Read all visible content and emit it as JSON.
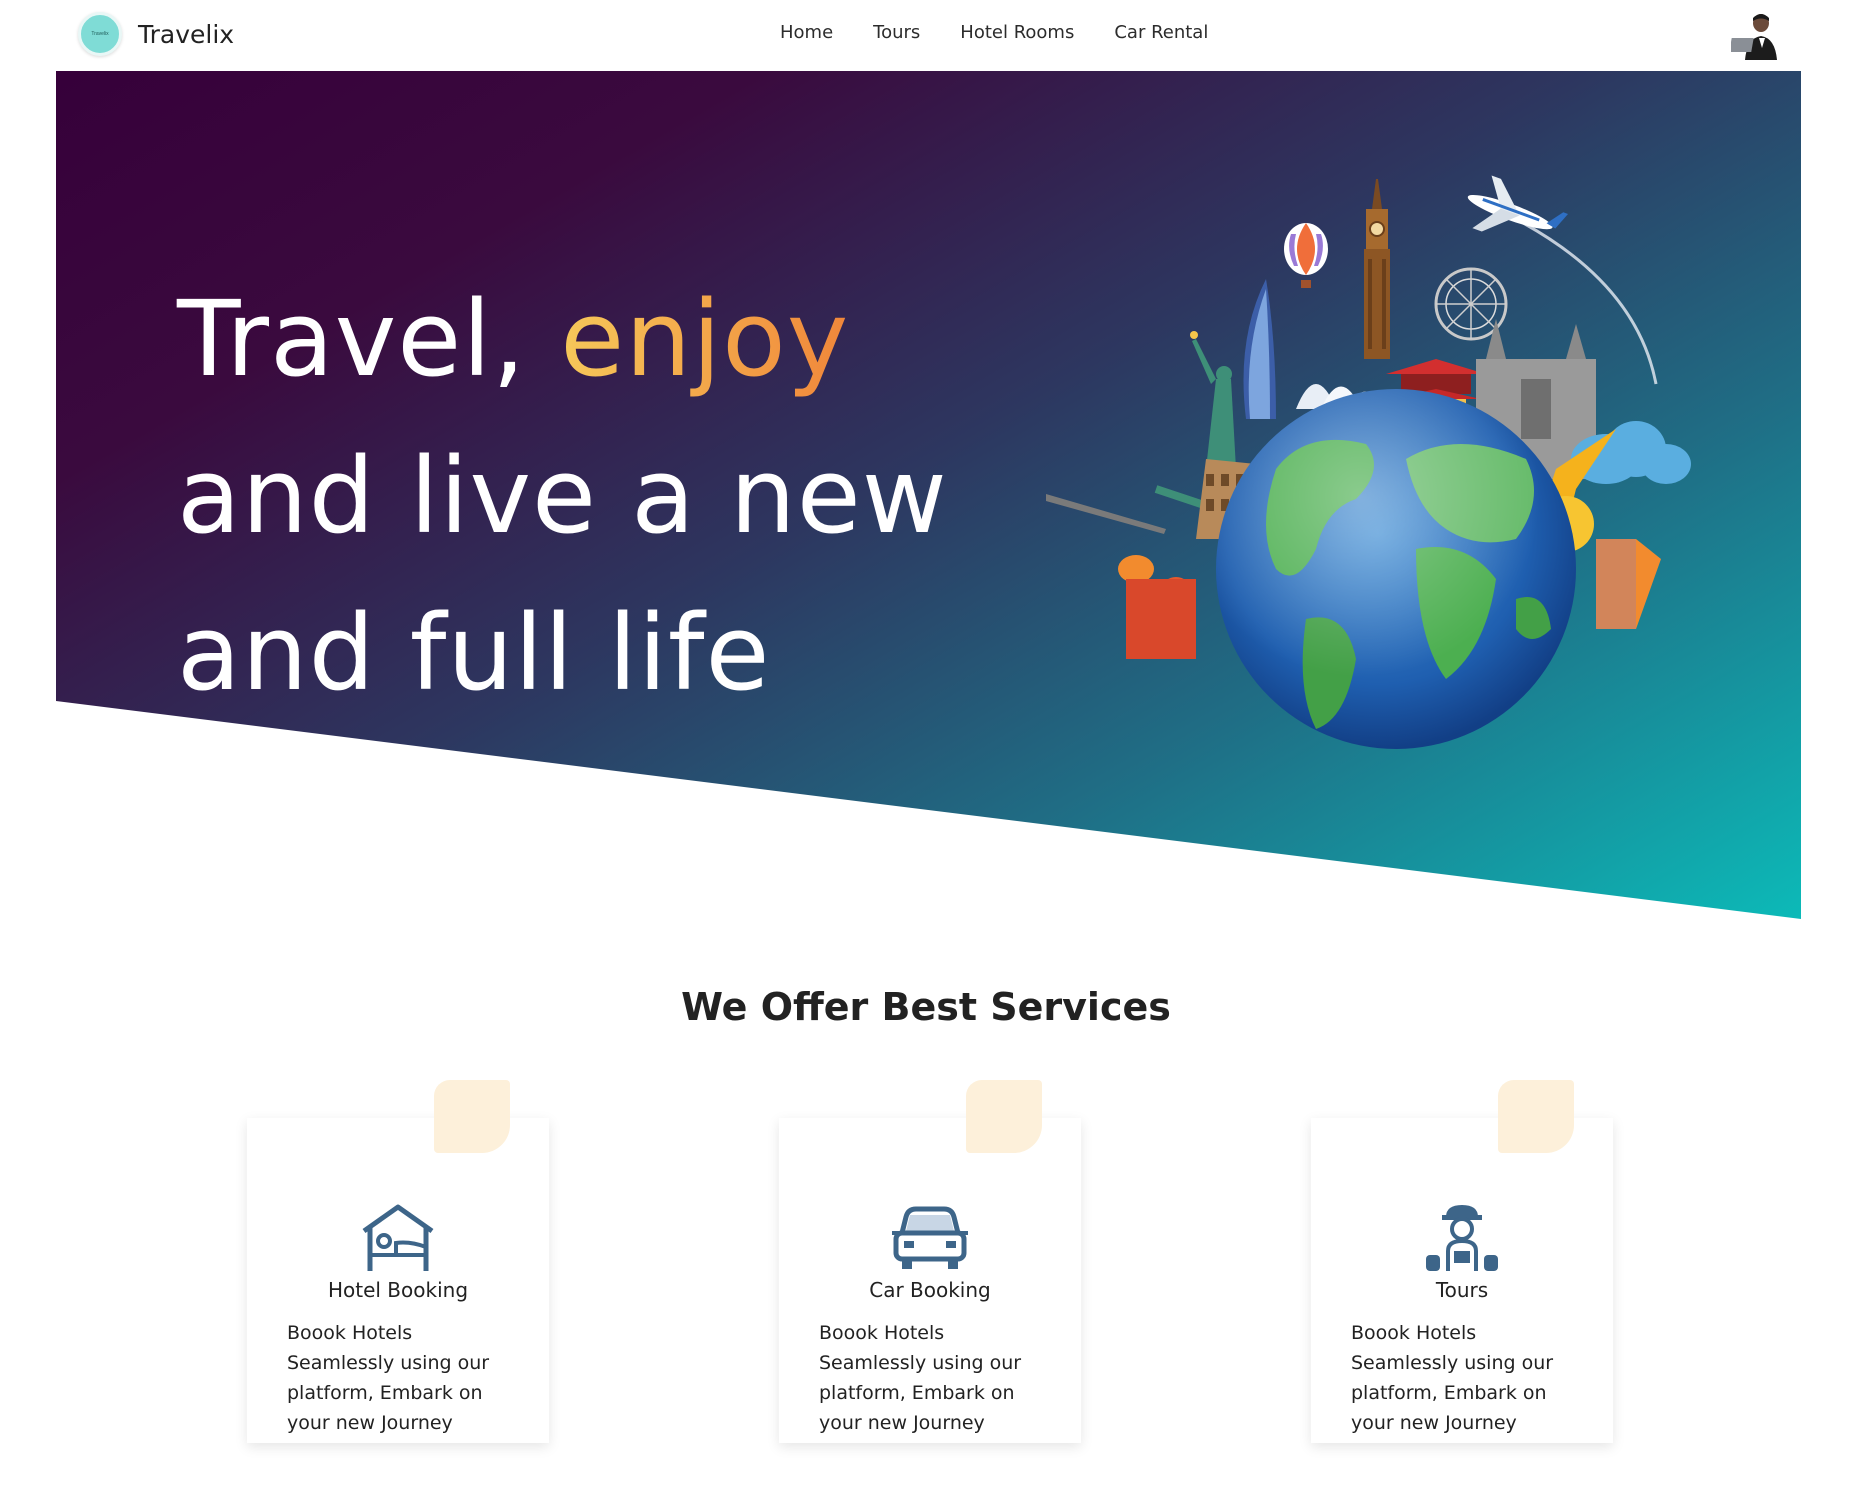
{
  "brand": {
    "name": "Travelix",
    "logo_text": "Travelix"
  },
  "nav": {
    "items": [
      "Home",
      "Tours",
      "Hotel Rooms",
      "Car Rental"
    ]
  },
  "hero": {
    "line1_part1": "Travel,",
    "line1_accent": "enjoy",
    "line2": "and live a new",
    "line3": "and full life"
  },
  "services": {
    "title": "We Offer Best Services",
    "cards": [
      {
        "icon": "hotel-bed-icon",
        "title": "Hotel Booking",
        "text": "Boook Hotels Seamlessly using our platform, Embark on your new Journey"
      },
      {
        "icon": "car-icon",
        "title": "Car Booking",
        "text": "Boook Hotels Seamlessly using our platform, Embark on your new Journey"
      },
      {
        "icon": "tour-guide-icon",
        "title": "Tours",
        "text": "Boook Hotels Seamlessly using our platform, Embark on your new Journey"
      }
    ]
  },
  "colors": {
    "hero_start": "#36003a",
    "hero_end": "#0cbab8",
    "accent_start": "#f6c85a",
    "accent_end": "#f0863a",
    "icon": "#3d6589",
    "card_deco": "#fdf0da"
  }
}
